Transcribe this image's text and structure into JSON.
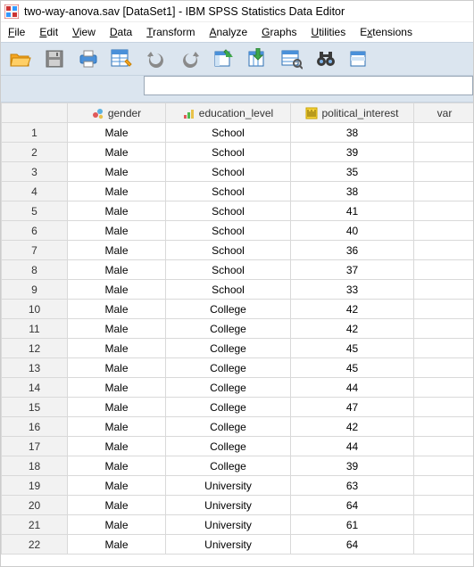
{
  "window": {
    "title": "two-way-anova.sav [DataSet1] - IBM SPSS Statistics Data Editor"
  },
  "menu": {
    "file": "File",
    "edit": "Edit",
    "view": "View",
    "data": "Data",
    "transform": "Transform",
    "analyze": "Analyze",
    "graphs": "Graphs",
    "utilities": "Utilities",
    "extensions": "Extensions"
  },
  "columns": {
    "gender": "gender",
    "education_level": "education_level",
    "political_interest": "political_interest",
    "var": "var"
  },
  "rows": [
    {
      "n": "1",
      "gender": "Male",
      "education_level": "School",
      "political_interest": "38"
    },
    {
      "n": "2",
      "gender": "Male",
      "education_level": "School",
      "political_interest": "39"
    },
    {
      "n": "3",
      "gender": "Male",
      "education_level": "School",
      "political_interest": "35"
    },
    {
      "n": "4",
      "gender": "Male",
      "education_level": "School",
      "political_interest": "38"
    },
    {
      "n": "5",
      "gender": "Male",
      "education_level": "School",
      "political_interest": "41"
    },
    {
      "n": "6",
      "gender": "Male",
      "education_level": "School",
      "political_interest": "40"
    },
    {
      "n": "7",
      "gender": "Male",
      "education_level": "School",
      "political_interest": "36"
    },
    {
      "n": "8",
      "gender": "Male",
      "education_level": "School",
      "political_interest": "37"
    },
    {
      "n": "9",
      "gender": "Male",
      "education_level": "School",
      "political_interest": "33"
    },
    {
      "n": "10",
      "gender": "Male",
      "education_level": "College",
      "political_interest": "42"
    },
    {
      "n": "11",
      "gender": "Male",
      "education_level": "College",
      "political_interest": "42"
    },
    {
      "n": "12",
      "gender": "Male",
      "education_level": "College",
      "political_interest": "45"
    },
    {
      "n": "13",
      "gender": "Male",
      "education_level": "College",
      "political_interest": "45"
    },
    {
      "n": "14",
      "gender": "Male",
      "education_level": "College",
      "political_interest": "44"
    },
    {
      "n": "15",
      "gender": "Male",
      "education_level": "College",
      "political_interest": "47"
    },
    {
      "n": "16",
      "gender": "Male",
      "education_level": "College",
      "political_interest": "42"
    },
    {
      "n": "17",
      "gender": "Male",
      "education_level": "College",
      "political_interest": "44"
    },
    {
      "n": "18",
      "gender": "Male",
      "education_level": "College",
      "political_interest": "39"
    },
    {
      "n": "19",
      "gender": "Male",
      "education_level": "University",
      "political_interest": "63"
    },
    {
      "n": "20",
      "gender": "Male",
      "education_level": "University",
      "political_interest": "64"
    },
    {
      "n": "21",
      "gender": "Male",
      "education_level": "University",
      "political_interest": "61"
    },
    {
      "n": "22",
      "gender": "Male",
      "education_level": "University",
      "political_interest": "64"
    }
  ]
}
